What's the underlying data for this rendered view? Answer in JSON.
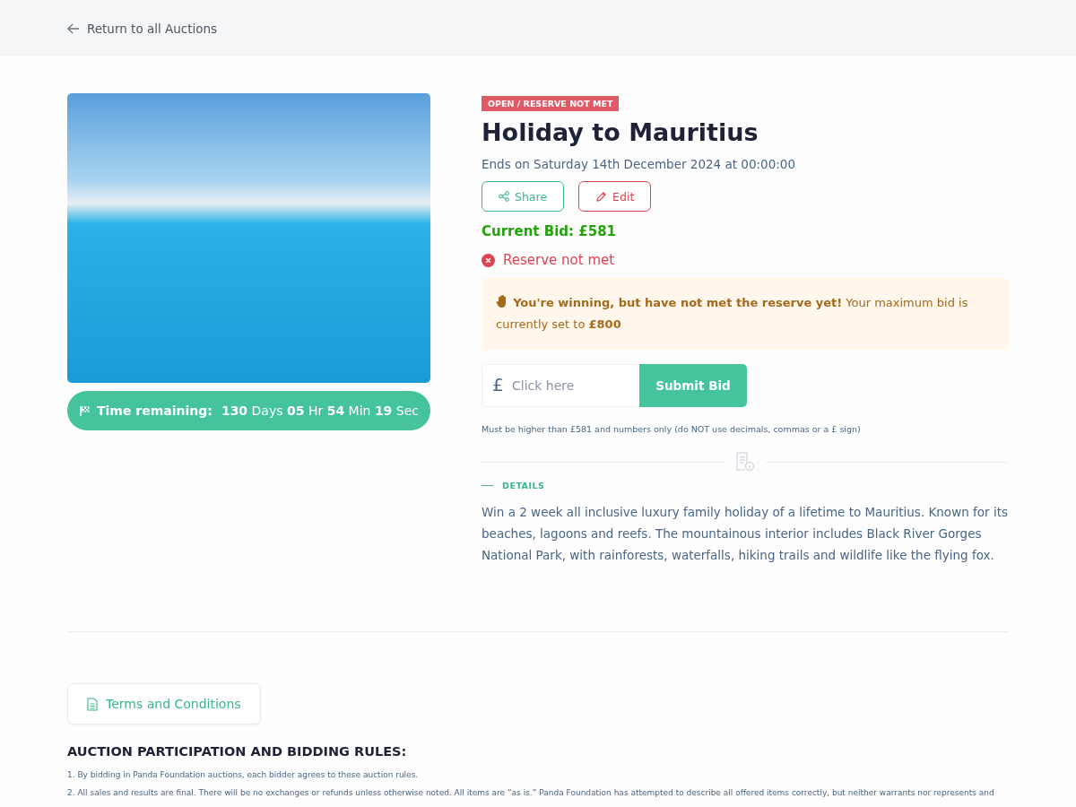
{
  "back_link": "Return to all Auctions",
  "status_badge": "OPEN / RESERVE NOT MET",
  "title": "Holiday to Mauritius",
  "ends": "Ends on Saturday 14th December 2024 at 00:00:00",
  "actions": [
    {
      "kind": "share",
      "label": "Share"
    },
    {
      "kind": "edit",
      "label": "Edit"
    }
  ],
  "current_bid": "Current Bid: £581",
  "reserve": {
    "met": false,
    "label": "Reserve not met"
  },
  "alert": "**You're winning, but have not met the reserve yet!** Your maximum bid is currently set to **£800**",
  "bid_form": {
    "currency": "£",
    "placeholder": "Click here",
    "submit": "Submit Bid",
    "hint": "Must be higher than £581 and numbers only (do NOT use decimals, commas or a £ sign)"
  },
  "time_remaining": {
    "label": "Time remaining:",
    "value": "**130** Days **05** Hr **54** Min **19** Sec"
  },
  "details": {
    "heading": "DETAILS",
    "text": "Win a 2 week all inclusive luxury family holiday of a lifetime to Mauritius. Known for its beaches, lagoons and reefs. The mountainous interior includes Black River Gorges National Park, with rainforests, waterfalls, hiking trails and wildlife like the flying fox."
  },
  "terms": {
    "button": "Terms and Conditions",
    "heading": "AUCTION PARTICIPATION AND BIDDING RULES:",
    "rules": [
      "1. By bidding in Panda Foundation auctions, each bidder agrees to these auction rules.",
      "2. All sales and results are final. There will be no exchanges or refunds unless otherwise noted. All items are “as is.” Panda Foundation has attempted to describe all offered items correctly, but neither warrants nor represents and"
    ]
  }
}
